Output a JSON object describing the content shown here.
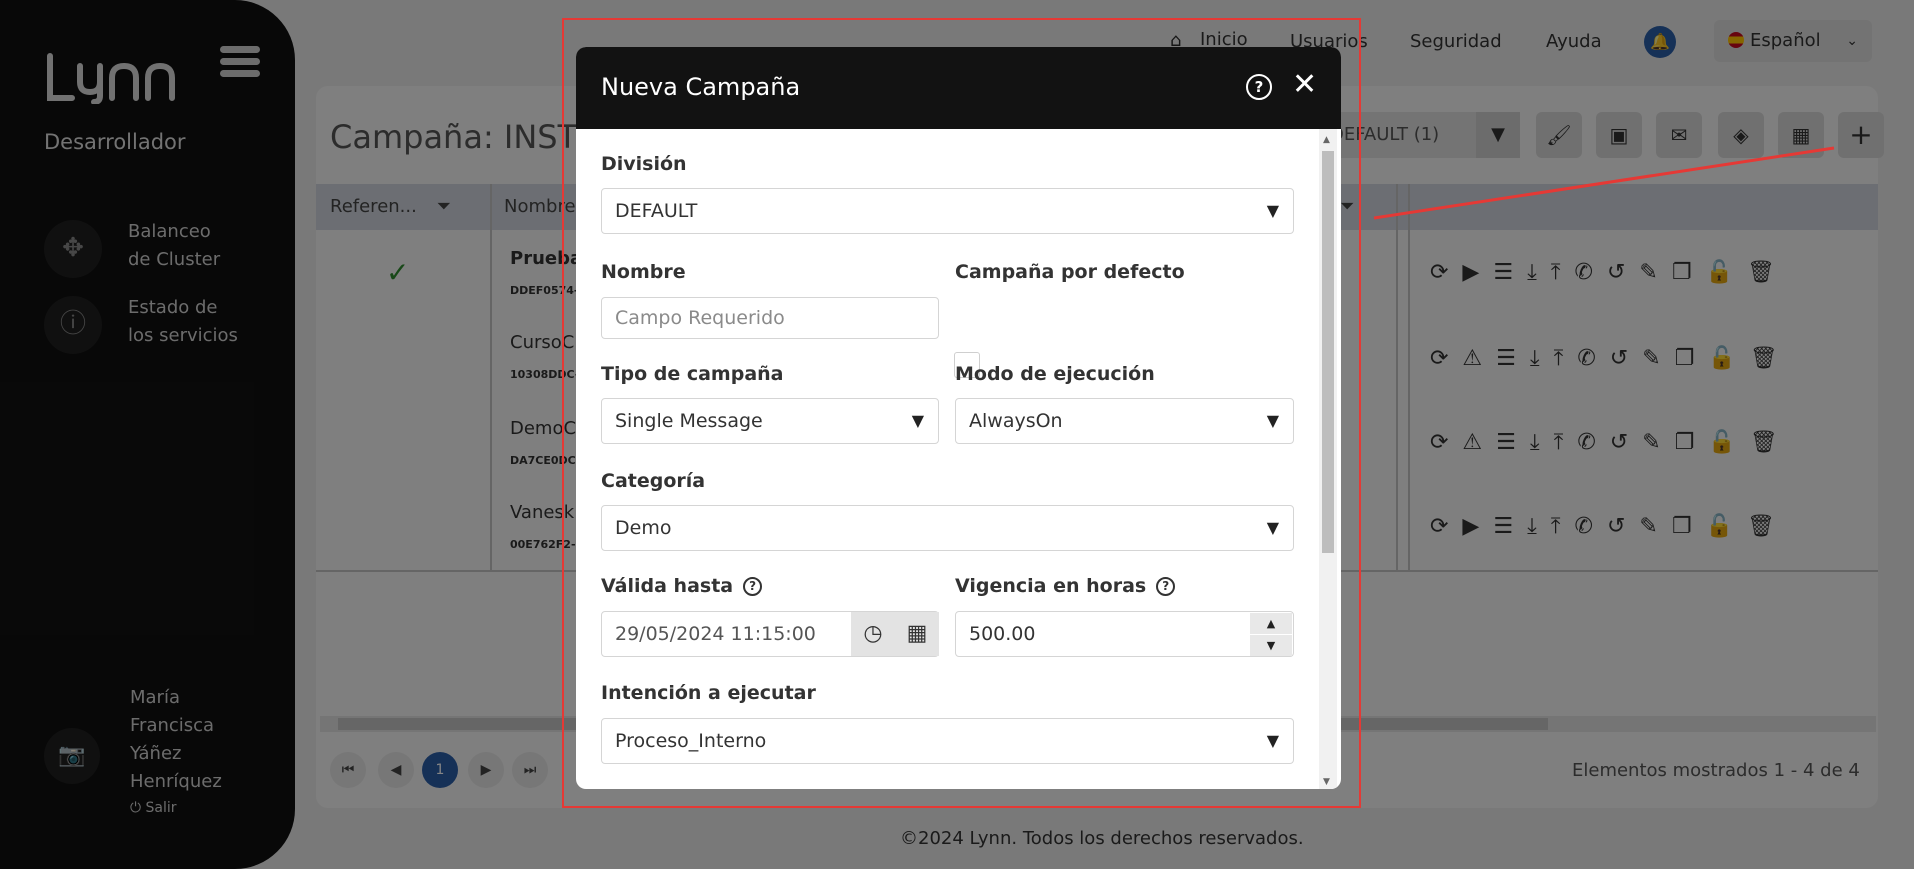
{
  "sidebar": {
    "logo": "LYNN",
    "role": "Desarrollador",
    "nav": [
      {
        "label_line1": "Balanceo",
        "label_line2": "de Cluster",
        "icon": "cluster-icon"
      },
      {
        "label_line1": "Estado de",
        "label_line2": "los servicios",
        "icon": "info-icon"
      }
    ],
    "user": {
      "line1": "María",
      "line2": "Francisca",
      "line3": "Yáñez",
      "line4": "Henríquez",
      "logout": "Salir"
    }
  },
  "topnav": {
    "home": "Inicio",
    "users": "Usuarios",
    "security": "Seguridad",
    "help": "Ayuda",
    "language": "Español"
  },
  "page": {
    "title": "Campaña: INST",
    "division_selector": "DEFAULT (1)",
    "columns": [
      "Referen...",
      "Nombre"
    ],
    "rows": [
      {
        "name": "Prueba",
        "id": "DDEF0574-"
      },
      {
        "name": "CursoC",
        "id": "10308DDC-"
      },
      {
        "name": "DemoC",
        "id": "DA7CE0DC"
      },
      {
        "name": "Vanesk",
        "id": "00E762F2-"
      }
    ],
    "pager": {
      "current": "1"
    },
    "showing": "Elementos mostrados 1 - 4 de 4",
    "footer": "©2024 Lynn. Todos los derechos reservados."
  },
  "modal": {
    "title": "Nueva Campaña",
    "division": {
      "label": "División",
      "value": "DEFAULT"
    },
    "nombre": {
      "label": "Nombre",
      "placeholder": "Campo Requerido"
    },
    "default_campaign": {
      "label": "Campaña por defecto",
      "checked": false
    },
    "tipo": {
      "label": "Tipo de campaña",
      "value": "Single Message"
    },
    "modo": {
      "label": "Modo de ejecución",
      "value": "AlwaysOn"
    },
    "categoria": {
      "label": "Categoría",
      "value": "Demo"
    },
    "valida": {
      "label": "Válida hasta",
      "value": "29/05/2024 11:15:00"
    },
    "vigencia": {
      "label": "Vigencia en horas",
      "value": "500.00"
    },
    "intencion": {
      "label": "Intención a ejecutar",
      "value": "Proceso_Interno"
    }
  },
  "colors": {
    "sidebar": "#111111",
    "accent": "#2b5ea8",
    "highlight": "#e53935",
    "modal_header": "#121212"
  }
}
